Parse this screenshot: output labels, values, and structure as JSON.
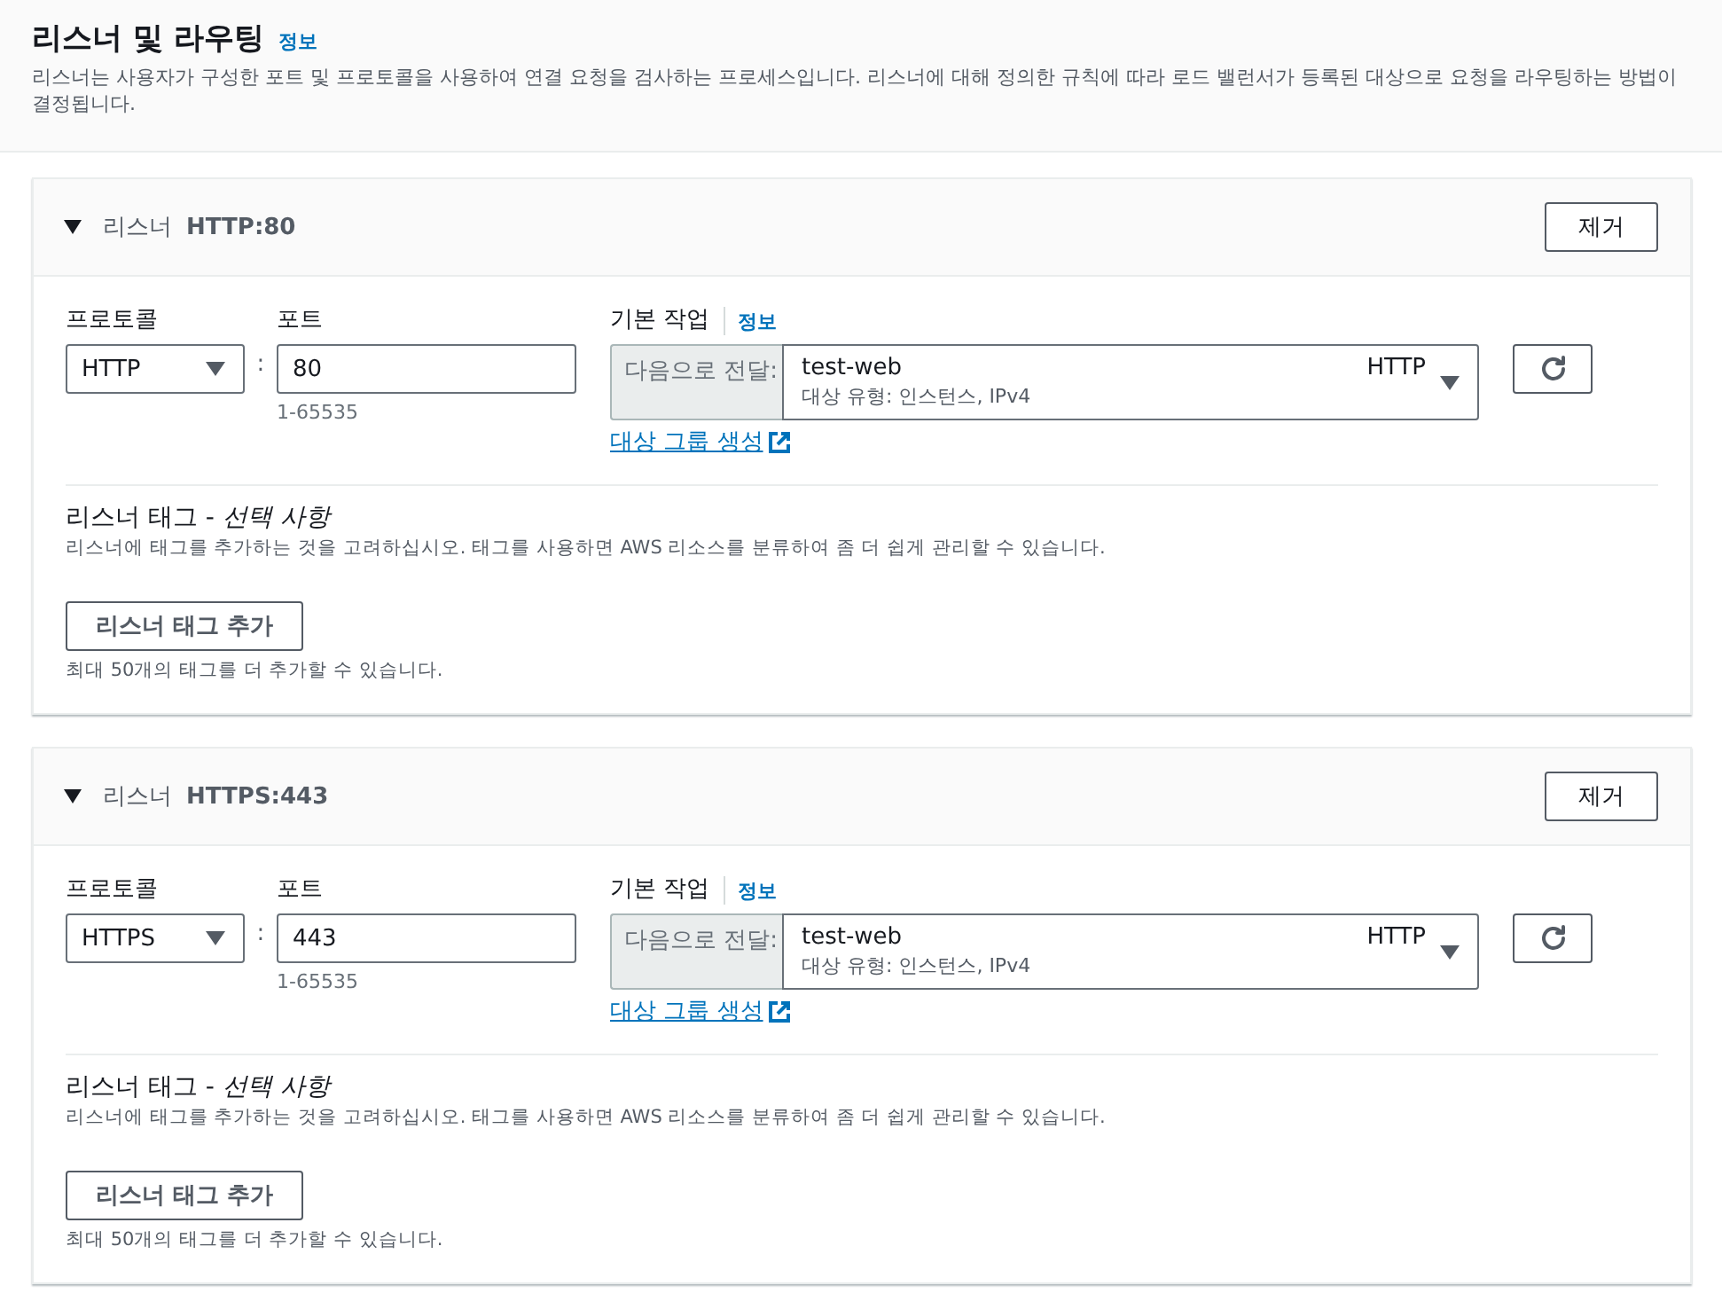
{
  "header": {
    "title": "리스너 및 라우팅",
    "info_link": "정보",
    "description": "리스너는 사용자가 구성한 포트 및 프로토콜을 사용하여 연결 요청을 검사하는 프로세스입니다. 리스너에 대해 정의한 규칙에 따라 로드 밸런서가 등록된 대상으로 요청을 라우팅하는 방법이 결정됩니다."
  },
  "listeners": [
    {
      "expanded": true,
      "label": "리스너",
      "name": "HTTP:80",
      "remove_button": "제거",
      "protocol": {
        "label": "프로토콜",
        "value": "HTTP"
      },
      "separator": ":",
      "port": {
        "label": "포트",
        "value": "80",
        "hint": "1-65535"
      },
      "default_action": {
        "label": "기본 작업",
        "info_link": "정보",
        "prefix": "다음으로 전달:",
        "target_group": "test-web",
        "target_protocol": "HTTP",
        "target_details": "대상 유형: 인스턴스, IPv4",
        "create_link": "대상 그룹 생성"
      },
      "tags": {
        "title": "리스너 태그 - *선택 사항*",
        "description": "리스너에 태그를 추가하는 것을 고려하십시오. 태그를 사용하면 AWS 리소스를 분류하여 좀 더 쉽게 관리할 수 있습니다.",
        "add_button": "리스너 태그 추가",
        "limit_note": "최대 50개의 태그를 더 추가할 수 있습니다."
      }
    },
    {
      "expanded": true,
      "label": "리스너",
      "name": "HTTPS:443",
      "remove_button": "제거",
      "protocol": {
        "label": "프로토콜",
        "value": "HTTPS"
      },
      "separator": ":",
      "port": {
        "label": "포트",
        "value": "443",
        "hint": "1-65535"
      },
      "default_action": {
        "label": "기본 작업",
        "info_link": "정보",
        "prefix": "다음으로 전달:",
        "target_group": "test-web",
        "target_protocol": "HTTP",
        "target_details": "대상 유형: 인스턴스, IPv4",
        "create_link": "대상 그룹 생성"
      },
      "tags": {
        "title": "리스너 태그 - *선택 사항*",
        "description": "리스너에 태그를 추가하는 것을 고려하십시오. 태그를 사용하면 AWS 리소스를 분류하여 좀 더 쉽게 관리할 수 있습니다.",
        "add_button": "리스너 태그 추가",
        "limit_note": "최대 50개의 태그를 더 추가할 수 있습니다."
      }
    }
  ]
}
